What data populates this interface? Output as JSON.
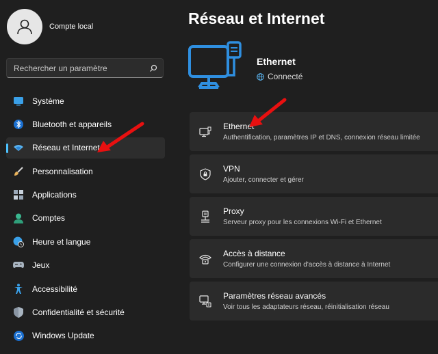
{
  "user": {
    "name": "Compte local"
  },
  "search": {
    "placeholder": "Rechercher un paramètre"
  },
  "sidebar": {
    "items": [
      {
        "label": "Système",
        "icon": "monitor-icon"
      },
      {
        "label": "Bluetooth et appareils",
        "icon": "bluetooth-icon"
      },
      {
        "label": "Réseau et Internet",
        "icon": "wifi-icon",
        "active": true
      },
      {
        "label": "Personnalisation",
        "icon": "brush-icon"
      },
      {
        "label": "Applications",
        "icon": "apps-icon"
      },
      {
        "label": "Comptes",
        "icon": "person-icon"
      },
      {
        "label": "Heure et langue",
        "icon": "globe-clock-icon"
      },
      {
        "label": "Jeux",
        "icon": "gamepad-icon"
      },
      {
        "label": "Accessibilité",
        "icon": "accessibility-icon"
      },
      {
        "label": "Confidentialité et sécurité",
        "icon": "shield-icon"
      },
      {
        "label": "Windows Update",
        "icon": "update-icon"
      }
    ]
  },
  "main": {
    "title": "Réseau et Internet",
    "hero": {
      "title": "Ethernet",
      "status": "Connecté"
    },
    "cards": [
      {
        "title": "Ethernet",
        "subtitle": "Authentification, paramètres IP et DNS, connexion réseau limitée",
        "icon": "ethernet-icon"
      },
      {
        "title": "VPN",
        "subtitle": "Ajouter, connecter et gérer",
        "icon": "vpn-shield-icon"
      },
      {
        "title": "Proxy",
        "subtitle": "Serveur proxy pour les connexions Wi-Fi et Ethernet",
        "icon": "proxy-icon"
      },
      {
        "title": "Accès à distance",
        "subtitle": "Configurer une connexion d'accès à distance à Internet",
        "icon": "dialup-icon"
      },
      {
        "title": "Paramètres réseau avancés",
        "subtitle": "Voir tous les adaptateurs réseau, réinitialisation réseau",
        "icon": "advanced-network-icon"
      }
    ]
  },
  "colors": {
    "accent": "#4cc2ff",
    "annotation": "#e81010",
    "hero_icon": "#2f8fe0"
  }
}
